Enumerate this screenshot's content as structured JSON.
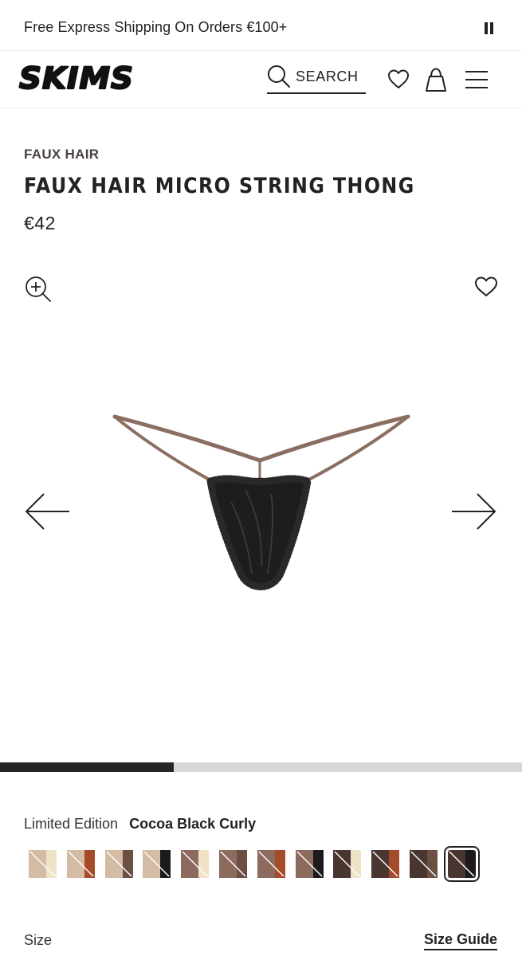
{
  "promo": {
    "text": "Free Express Shipping On Orders €100+",
    "pause_icon": "pause-icon"
  },
  "header": {
    "logo_text": "SKIMS",
    "search_label": "SEARCH",
    "icons": [
      "search-icon",
      "heart-icon",
      "bag-icon",
      "menu-icon"
    ]
  },
  "product": {
    "collection": "FAUX HAIR",
    "title": "FAUX HAIR MICRO STRING THONG",
    "price": "€42"
  },
  "gallery": {
    "image_progress": 0.333,
    "icons": [
      "zoom-in-icon",
      "heart-icon",
      "arrow-left-icon",
      "arrow-right-icon"
    ]
  },
  "color": {
    "label": "Limited Edition",
    "selected_name": "Cocoa Black Curly",
    "swatches": [
      {
        "left": "#d4bba4",
        "right": "#efe3c7",
        "selected": false
      },
      {
        "left": "#d4bba4",
        "right": "#a64b2a",
        "selected": false
      },
      {
        "left": "#d4bba4",
        "right": "#6b4f43",
        "selected": false
      },
      {
        "left": "#d4bba4",
        "right": "#1c1a1a",
        "selected": false
      },
      {
        "left": "#8c6a5e",
        "right": "#efe3c7",
        "selected": false
      },
      {
        "left": "#8c6a5e",
        "right": "#6b4f43",
        "selected": false
      },
      {
        "left": "#8c6a5e",
        "right": "#a64b2a",
        "selected": false
      },
      {
        "left": "#8c6a5e",
        "right": "#1c1a1a",
        "selected": false
      },
      {
        "left": "#4a3630",
        "right": "#efe3c7",
        "selected": false
      },
      {
        "left": "#4a3630",
        "right": "#a64b2a",
        "selected": false
      },
      {
        "left": "#4a3630",
        "right": "#6b4f43",
        "selected": false
      },
      {
        "left": "#4a3630",
        "right": "#1c1a1a",
        "selected": true
      }
    ]
  },
  "size": {
    "label": "Size",
    "guide_label": "Size Guide"
  },
  "colors": {
    "text": "#222222",
    "track": "#d9d6d6",
    "fill": "#262323",
    "strap": "#8a6e62",
    "fabric": "#1e1d1d"
  }
}
